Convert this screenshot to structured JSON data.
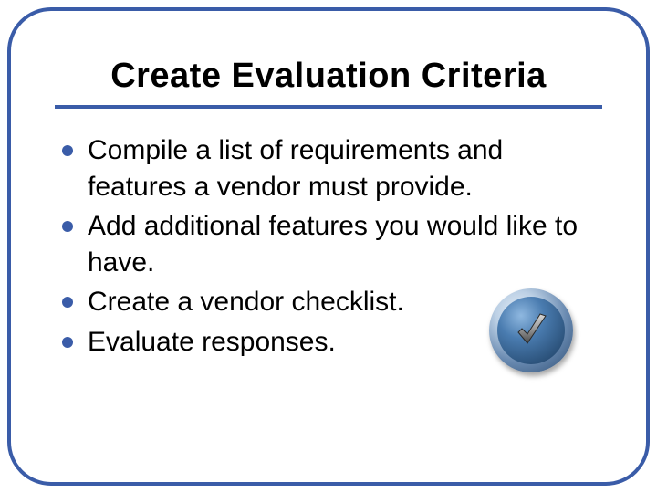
{
  "slide": {
    "title": "Create Evaluation Criteria",
    "bullets": [
      "Compile a list of requirements and features a vendor must provide.",
      "Add additional features you would like to have.",
      "Create a vendor checklist.",
      "Evaluate responses."
    ],
    "accent_color": "#3a5ca8"
  }
}
